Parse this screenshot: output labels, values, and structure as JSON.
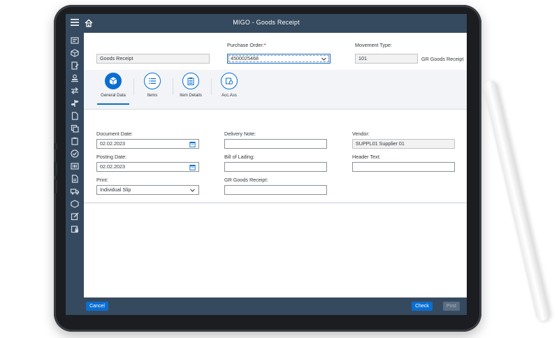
{
  "header": {
    "title": "MIGO - Goods Receipt"
  },
  "top": {
    "action_value": "Goods Receipt",
    "po_label": "Purchase Order:",
    "po_required": "*",
    "po_value": "4500025468",
    "movement_label": "Movement Type:",
    "movement_value": "101",
    "movement_desc": "GR Goods Receipt"
  },
  "tabs": [
    {
      "label": "General Data",
      "icon": "cube-icon",
      "active": true
    },
    {
      "label": "Items",
      "icon": "list-icon",
      "active": false
    },
    {
      "label": "Item Details",
      "icon": "clipboard-icon",
      "active": false
    },
    {
      "label": "Acc.Ass",
      "icon": "account-assignment-icon",
      "active": false
    }
  ],
  "general": {
    "document_date_label": "Document Date:",
    "document_date_value": "02.02.2023",
    "posting_date_label": "Posting Date:",
    "posting_date_value": "02.02.2023",
    "print_label": "Print:",
    "print_value": "Individual Slip",
    "delivery_note_label": "Delivery Note:",
    "delivery_note_value": "",
    "bill_of_lading_label": "Bill of Lading:",
    "bill_of_lading_value": "",
    "gr_receipt_label": "GR Goods Receipt:",
    "gr_receipt_value": "",
    "vendor_label": "Vendor:",
    "vendor_value": "SUPPL01 Supplier 01",
    "header_text_label": "Header Text:",
    "header_text_value": ""
  },
  "footer": {
    "cancel_label": "Cancel",
    "check_label": "Check",
    "post_label": "Post"
  },
  "colors": {
    "shell": "#354a5f",
    "accent": "#0a6ed1",
    "required": "#bb0000"
  }
}
